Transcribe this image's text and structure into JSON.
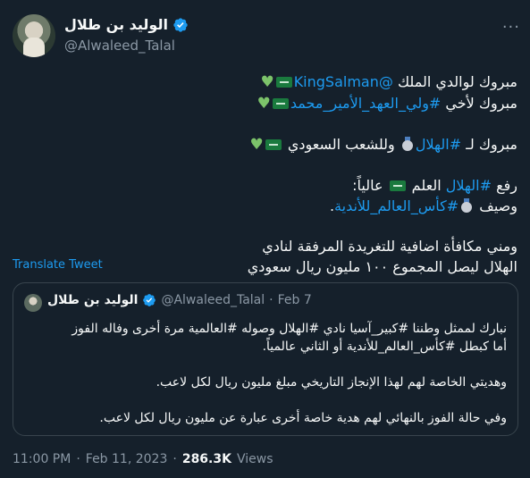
{
  "author": {
    "display_name": "الوليد بن طلال",
    "handle": "@Alwaleed_Talal"
  },
  "tweet": {
    "line1_text": "مبروك لوالدي الملك ",
    "line1_mention": "@KingSalman",
    "line2_text": "مبروك لأخي ",
    "line2_hashtag": "#ولي_العهد_الأمير_محمد",
    "line3_text": "مبروك لـ ",
    "line3_hashtag": "#الهلال",
    "line3_rest": " وللشعب السعودي ",
    "line4_text": "رفع ",
    "line4_hashtag": "#الهلال",
    "line4_rest": " العلم ",
    "line4_end": " عالياً:",
    "line5_text": "وصيف ",
    "line5_hashtag": "#كأس_العالم_للأندية",
    "line5_end": ".",
    "line6": "ومني مكافأة اضافية للتغريدة المرفقة لنادي",
    "line7": "الهلال ليصل المجموع ١٠٠ مليون ريال سعودي"
  },
  "translate_label": "Translate Tweet",
  "quoted": {
    "display_name": "الوليد بن طلال",
    "handle": "@Alwaleed_Talal",
    "separator": "·",
    "date": "Feb 7",
    "line1": "نبارك لممثل وطننا  #كبير_آسيا نادي #الهلال وصوله #العالمية مرة أخرى وفاله الفوز",
    "line2": "أما كبطل #كأس_العالم_للأندية أو الثاني عالمياً.",
    "line3": "وهديتي الخاصة لهم لهذا الإنجاز التاريخي مبلغ مليون ريال لكل لاعب.",
    "line4": "وفي حالة الفوز بالنهائي لهم هدية خاصة أخرى عبارة عن مليون ريال لكل لاعب."
  },
  "footer": {
    "time": "11:00 PM",
    "dot": "·",
    "date": "Feb 11, 2023",
    "dot2": "·",
    "views": "286.3K",
    "views_label": "Views"
  },
  "icons": {
    "verified": "verified-badge-icon",
    "more": "more-options-icon",
    "heart": "green-heart-icon",
    "flag": "saudi-flag-icon",
    "medal": "silver-medal-icon"
  },
  "colors": {
    "background": "#15202b",
    "link": "#1d9bf0",
    "muted": "#8b98a5",
    "border": "#38444d",
    "verified": "#1d9bf0"
  }
}
